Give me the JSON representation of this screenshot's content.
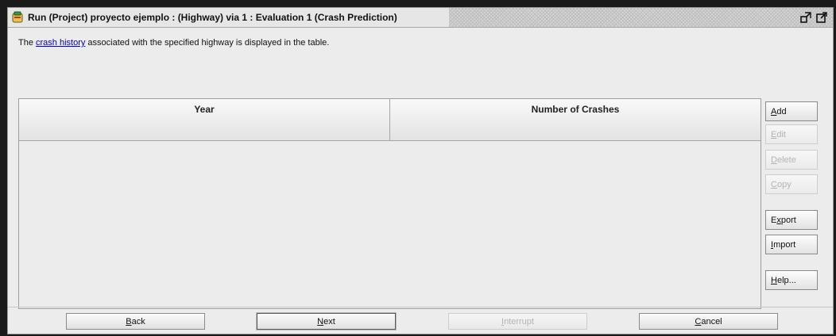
{
  "window": {
    "title": "Run (Project) proyecto ejemplo : (Highway) via 1 : Evaluation 1 (Crash Prediction)",
    "icon": "app-icon",
    "controls": [
      "restore-icon",
      "maximize-icon"
    ]
  },
  "info": {
    "prefix": "The ",
    "link": "crash history",
    "suffix": " associated with the specified highway is displayed in the table."
  },
  "table": {
    "columns": [
      "Year",
      "Number of Crashes"
    ],
    "rows": []
  },
  "side_buttons": {
    "add": {
      "mnemonic": "A",
      "rest": "dd",
      "enabled": true
    },
    "edit": {
      "mnemonic": "E",
      "rest": "dit",
      "enabled": false
    },
    "delete": {
      "mnemonic": "D",
      "rest": "elete",
      "enabled": false
    },
    "copy": {
      "mnemonic": "C",
      "rest": "opy",
      "enabled": false
    },
    "export": {
      "pre": "E",
      "mnemonic": "x",
      "rest": "port",
      "enabled": true
    },
    "import": {
      "mnemonic": "I",
      "rest": "mport",
      "enabled": true
    },
    "help": {
      "mnemonic": "H",
      "rest": "elp...",
      "enabled": true
    }
  },
  "bottom_buttons": {
    "back": {
      "mnemonic": "B",
      "rest": "ack",
      "enabled": true
    },
    "next": {
      "mnemonic": "N",
      "rest": "ext",
      "enabled": true
    },
    "interrupt": {
      "mnemonic": "I",
      "rest": "nterrupt",
      "enabled": false
    },
    "cancel": {
      "mnemonic": "C",
      "rest": "ancel",
      "enabled": true
    }
  }
}
